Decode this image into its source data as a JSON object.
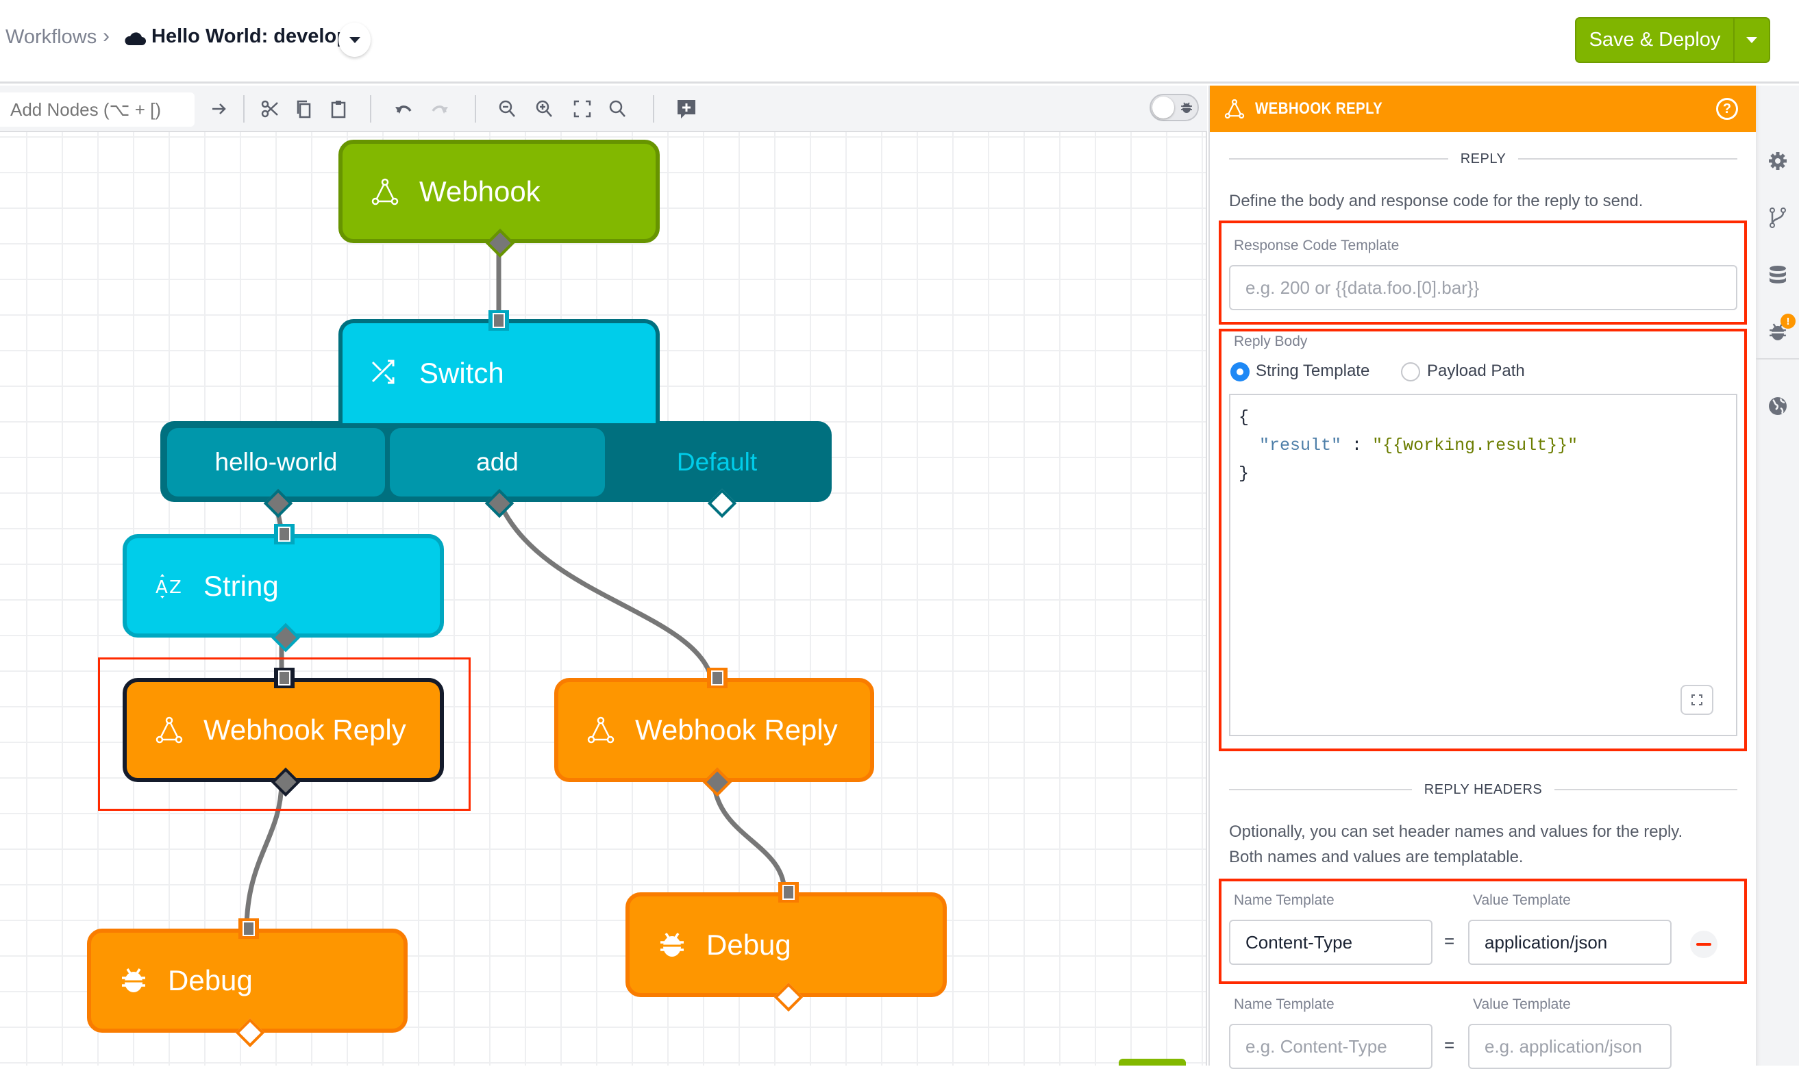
{
  "header": {
    "breadcrumb_root": "Workflows",
    "breadcrumb_separator": "›",
    "workflow_title": "Hello World: develop",
    "deploy_button": "Save & Deploy"
  },
  "toolbar": {
    "add_nodes_placeholder": "Add Nodes (⌥ + [)",
    "icons": [
      "arrow-right",
      "cut",
      "copy",
      "paste",
      "undo",
      "redo",
      "zoom-out",
      "zoom-in",
      "fit-to-screen",
      "zoom-reset",
      "add-comment"
    ],
    "debug_toggle_on": false
  },
  "canvas": {
    "nodes": {
      "webhook": "Webhook",
      "switch": "Switch",
      "switch_cases": [
        "hello-world",
        "add",
        "Default"
      ],
      "string": "String",
      "webhook_reply_left": "Webhook Reply",
      "webhook_reply_right": "Webhook Reply",
      "debug_left": "Debug",
      "debug_right": "Debug"
    },
    "selected_node": "webhook_reply_left"
  },
  "panel": {
    "title": "WEBHOOK REPLY",
    "accent_color": "#fe9600",
    "reply_section": "REPLY",
    "reply_description": "Define the body and response code for the reply to send.",
    "response_code_label": "Response Code Template",
    "response_code_value": "",
    "response_code_placeholder": "e.g. 200 or {{data.foo.[0].bar}}",
    "reply_body_label": "Reply Body",
    "reply_body_options": [
      "String Template",
      "Payload Path"
    ],
    "reply_body_selected": "String Template",
    "code": {
      "open": "{",
      "key": "\"result\"",
      "colon": " : ",
      "value": "\"{{working.result}}\"",
      "close": "}"
    },
    "headers_section": "REPLY HEADERS",
    "headers_description_1": "Optionally, you can set header names and values for the reply.",
    "headers_description_2": "Both names and values are templatable.",
    "headers": [
      {
        "name_label": "Name Template",
        "value_label": "Value Template",
        "name": "Content-Type",
        "value": "application/json",
        "eq": "="
      },
      {
        "name_label": "Name Template",
        "value_label": "Value Template",
        "name_placeholder": "e.g. Content-Type",
        "value_placeholder": "e.g. application/json",
        "eq": "="
      }
    ]
  },
  "rail": {
    "icons": [
      "settings",
      "versions",
      "storage",
      "debug",
      "globe"
    ],
    "debug_badge": "!"
  }
}
